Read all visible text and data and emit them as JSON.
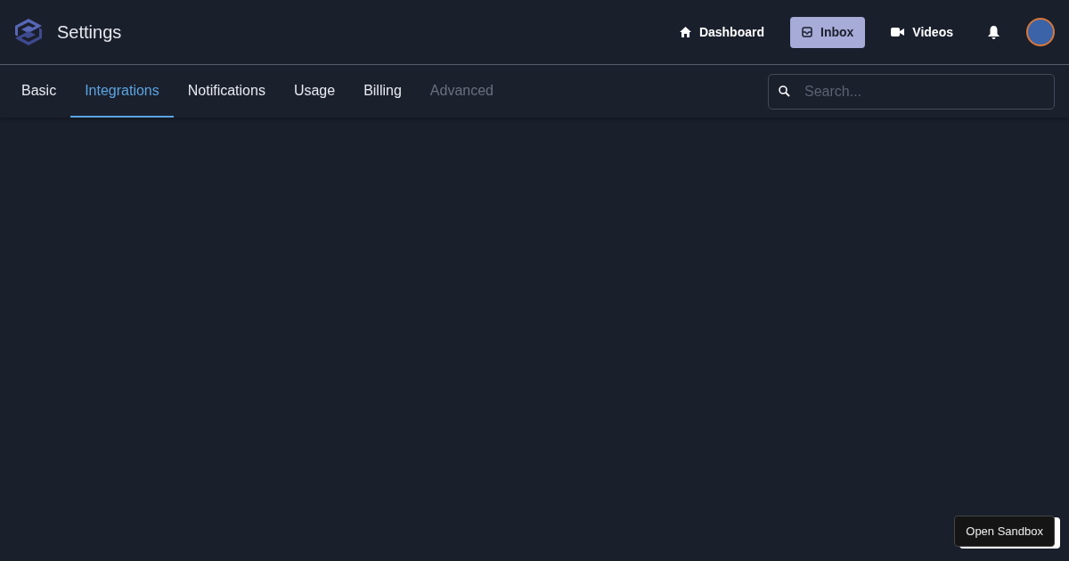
{
  "header": {
    "title": "Settings"
  },
  "nav": [
    {
      "label": "Dashboard",
      "kind": "home",
      "selected": false
    },
    {
      "label": "Inbox",
      "kind": "inbox",
      "selected": true
    },
    {
      "label": "Videos",
      "kind": "video",
      "selected": false
    }
  ],
  "tabs": [
    {
      "label": "Basic",
      "selected": false,
      "disabled": false
    },
    {
      "label": "Integrations",
      "selected": true,
      "disabled": false
    },
    {
      "label": "Notifications",
      "selected": false,
      "disabled": false
    },
    {
      "label": "Usage",
      "selected": false,
      "disabled": false
    },
    {
      "label": "Billing",
      "selected": false,
      "disabled": false
    },
    {
      "label": "Advanced",
      "selected": false,
      "disabled": true
    }
  ],
  "search": {
    "placeholder": "Search..."
  },
  "sandbox_button": {
    "label": "Open Sandbox"
  }
}
